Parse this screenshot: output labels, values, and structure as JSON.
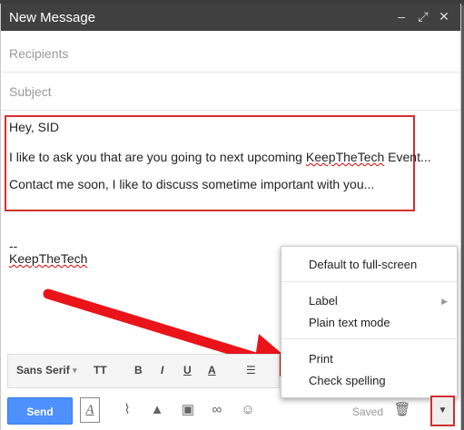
{
  "window": {
    "title": "New Message",
    "controls": [
      "–",
      "⤢",
      "✕"
    ]
  },
  "recipients": {
    "placeholder": "Recipients"
  },
  "subject": {
    "placeholder": "Subject"
  },
  "body": {
    "greeting": "Hey, SID",
    "line1_pre": "I like to ask you that are you going to next upcoming ",
    "line1_word": "KeepTheTech",
    "line1_post": " Event...",
    "line2": "Contact me soon, I like to discuss sometime important with you...",
    "sig_dash": "--",
    "signature": "KeepTheTech"
  },
  "menu": {
    "items": [
      "Default to full-screen",
      "Label",
      "Plain text mode",
      "Print",
      "Check spelling"
    ],
    "submenu_arrow": "▶"
  },
  "formatting": {
    "font": "Sans Serif",
    "size_icon": "TT",
    "bold": "B",
    "italic": "I",
    "underline": "U",
    "text_color": "A"
  },
  "bottom": {
    "send": "Send",
    "format_icon": "A",
    "saved": "Saved",
    "more_arrow": "▼"
  },
  "colors": {
    "send": "#4d90fe",
    "highlight": "#d32f2f",
    "titlebar": "#404040"
  }
}
